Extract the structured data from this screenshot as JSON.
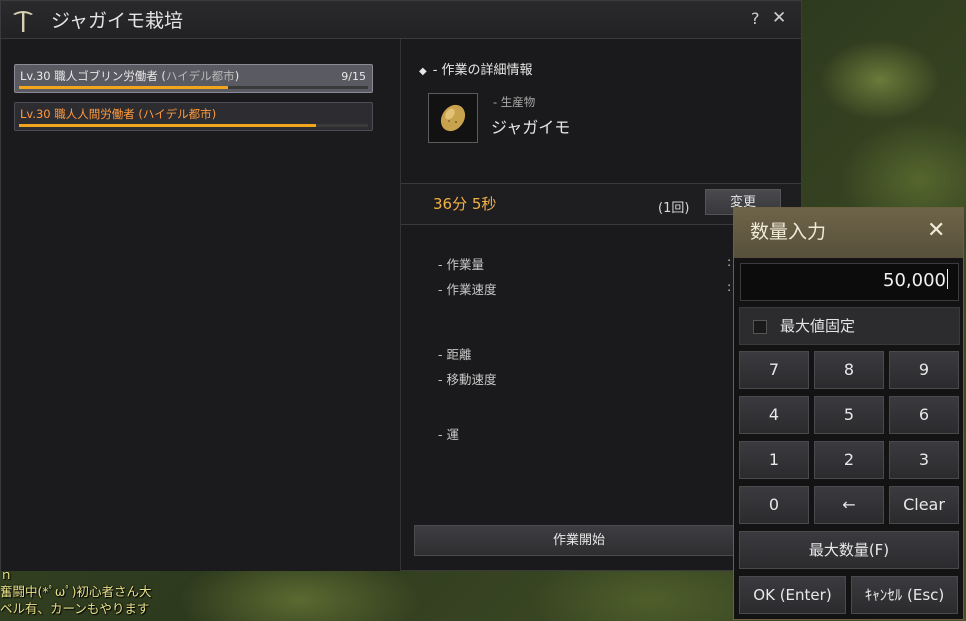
{
  "window": {
    "title": "ジャガイモ栽培",
    "help_label": "?",
    "close_label": "✕"
  },
  "workers": [
    {
      "level": "Lv.30 職人ゴブリン労働者 (",
      "city": "ハイデル都市",
      "suffix": ")",
      "count": "9/15",
      "stamina": 0.6,
      "selected": true,
      "color": "white"
    },
    {
      "level": "Lv.30 職人人間労働者 (",
      "city": "ハイデル都市",
      "suffix": ")",
      "count": "",
      "stamina": 0.85,
      "selected": false,
      "color": "orange"
    }
  ],
  "detail": {
    "section_title": "- 作業の詳細情報",
    "product_caption": "- 生産物",
    "product_name": "ジャガイモ",
    "time": "36分 5秒",
    "count": "(1回)",
    "change_label": "変更",
    "stats": [
      {
        "label": "- 作業量"
      },
      {
        "label": "- 作業速度"
      },
      {
        "label": "- 距離"
      },
      {
        "label": "- 移動速度"
      },
      {
        "label": "- 運"
      }
    ],
    "start_label": "作業開始"
  },
  "numpad": {
    "title": "数量入力",
    "close_label": "✕",
    "value": "50,000",
    "max_fix_label": "最大値固定",
    "max_fix_checked": false,
    "keys": [
      "7",
      "8",
      "9",
      "4",
      "5",
      "6",
      "1",
      "2",
      "3",
      "0",
      "←",
      "Clear"
    ],
    "max_label": "最大数量(F)",
    "ok_label": "OK (Enter)",
    "cancel_label": "ｷｬﾝｾﾙ (Esc)"
  },
  "chat": [
    "ｎ",
    "奮闘中(*ﾟωﾟ)初心者さん大",
    "ベル有、カーンもやります"
  ],
  "colors": {
    "accent_orange": "#f2a51c",
    "time_color": "#f2b144",
    "numpad_header": "#6e6449"
  }
}
